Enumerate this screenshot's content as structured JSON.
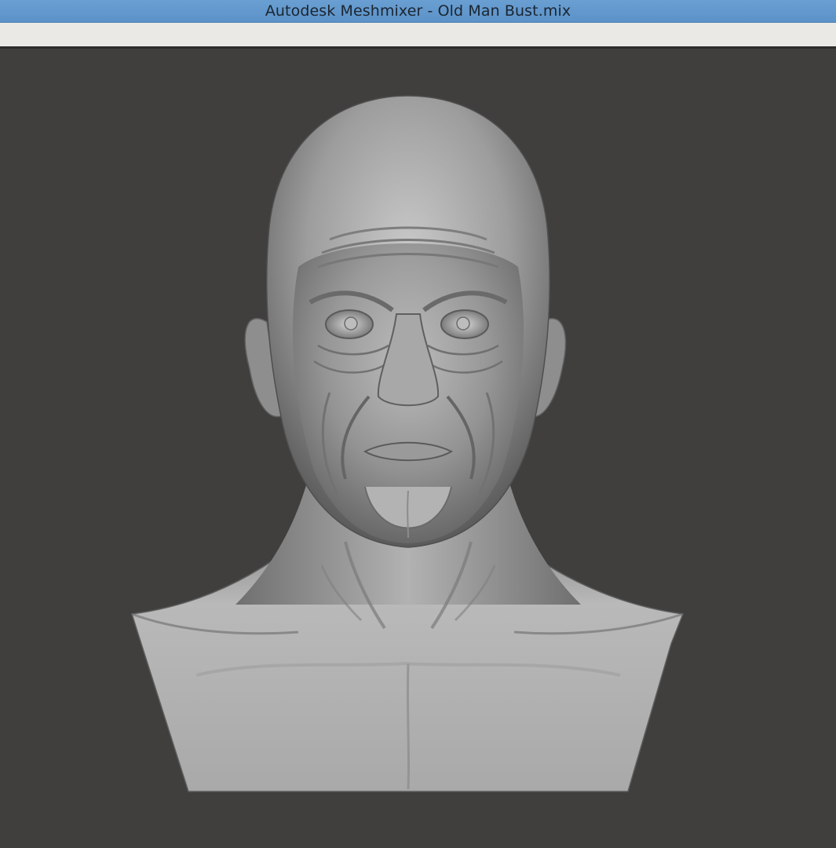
{
  "window": {
    "title": "Autodesk Meshmixer - Old Man Bust.mix"
  },
  "viewport": {
    "background_color": "#403f3e",
    "model_color": "#8c8c8c"
  }
}
